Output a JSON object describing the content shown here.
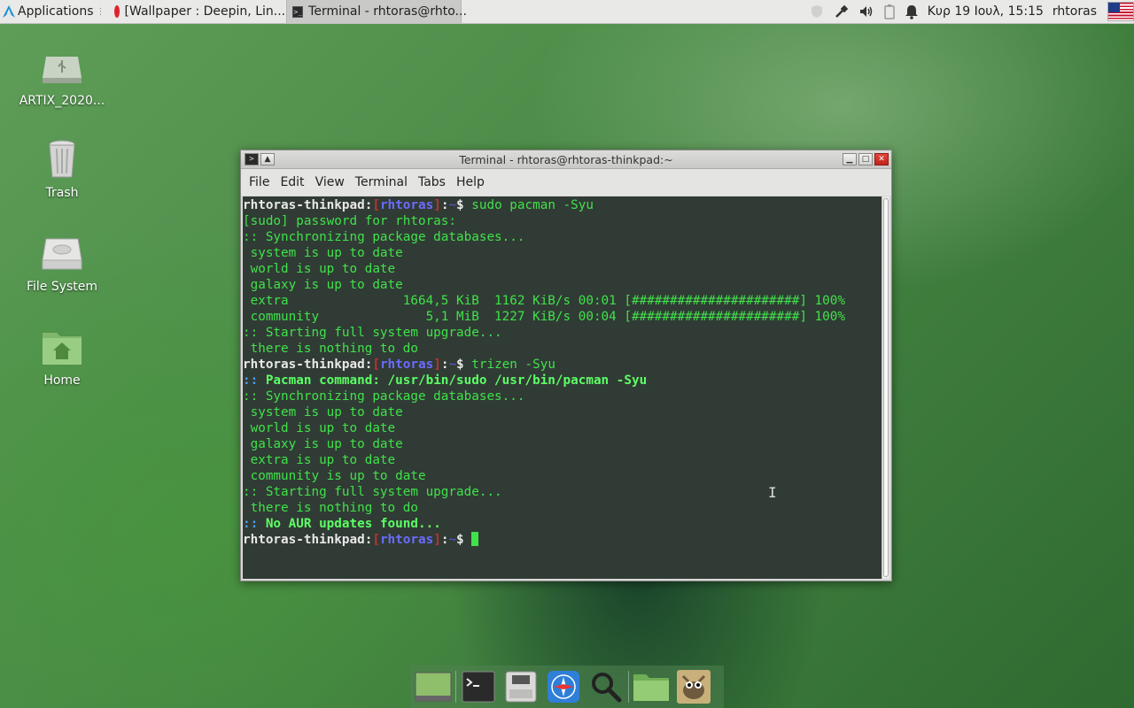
{
  "top_panel": {
    "applications_label": "Applications",
    "tasks": [
      {
        "label": "[Wallpaper : Deepin, Lin..."
      },
      {
        "label": "Terminal - rhtoras@rhto..."
      }
    ],
    "clock": "Κυρ 19 Ιουλ, 15:15",
    "username": "rhtoras"
  },
  "desktop_icons": [
    {
      "label": "ARTIX_2020..."
    },
    {
      "label": "Trash"
    },
    {
      "label": "File System"
    },
    {
      "label": "Home"
    }
  ],
  "window": {
    "title": "Terminal - rhtoras@rhtoras-thinkpad:~",
    "menu": [
      "File",
      "Edit",
      "View",
      "Terminal",
      "Tabs",
      "Help"
    ]
  },
  "terminal": {
    "prompt_host": "rhtoras-thinkpad",
    "prompt_user": "rhtoras",
    "prompt_dir": "~",
    "lines": [
      {
        "kind": "prompt",
        "text": "sudo pacman -Syu"
      },
      {
        "kind": "plain",
        "text": "[sudo] password for rhtoras:"
      },
      {
        "kind": "plain",
        "text": ":: Synchronizing package databases..."
      },
      {
        "kind": "plain",
        "text": " system is up to date"
      },
      {
        "kind": "plain",
        "text": " world is up to date"
      },
      {
        "kind": "plain",
        "text": " galaxy is up to date"
      },
      {
        "kind": "plain",
        "text": " extra               1664,5 KiB  1162 KiB/s 00:01 [######################] 100%"
      },
      {
        "kind": "plain",
        "text": " community              5,1 MiB  1227 KiB/s 00:04 [######################] 100%"
      },
      {
        "kind": "plain",
        "text": ":: Starting full system upgrade..."
      },
      {
        "kind": "plain",
        "text": " there is nothing to do"
      },
      {
        "kind": "prompt",
        "text": "trizen -Syu"
      },
      {
        "kind": "arrow",
        "prefix": "::",
        "text": " Pacman command: /usr/bin/sudo /usr/bin/pacman -Syu"
      },
      {
        "kind": "plain",
        "text": ":: Synchronizing package databases..."
      },
      {
        "kind": "plain",
        "text": " system is up to date"
      },
      {
        "kind": "plain",
        "text": " world is up to date"
      },
      {
        "kind": "plain",
        "text": " galaxy is up to date"
      },
      {
        "kind": "plain",
        "text": " extra is up to date"
      },
      {
        "kind": "plain",
        "text": " community is up to date"
      },
      {
        "kind": "plain",
        "text": ":: Starting full system upgrade..."
      },
      {
        "kind": "plain",
        "text": " there is nothing to do"
      },
      {
        "kind": "arrow",
        "prefix": "::",
        "text": " No AUR updates found..."
      },
      {
        "kind": "prompt",
        "text": ""
      }
    ]
  },
  "dock": {
    "items": [
      "show-desktop-icon",
      "terminal-icon",
      "file-manager-drive-icon",
      "web-browser-icon",
      "search-icon",
      "folder-icon",
      "gimp-icon"
    ]
  },
  "colors": {
    "terminal_fg": "#3fe24a",
    "prompt_user": "#6b6bff",
    "prompt_bracket": "#c03030",
    "arrow_blue": "#4a9ff0",
    "close_button": "#d4362c"
  }
}
